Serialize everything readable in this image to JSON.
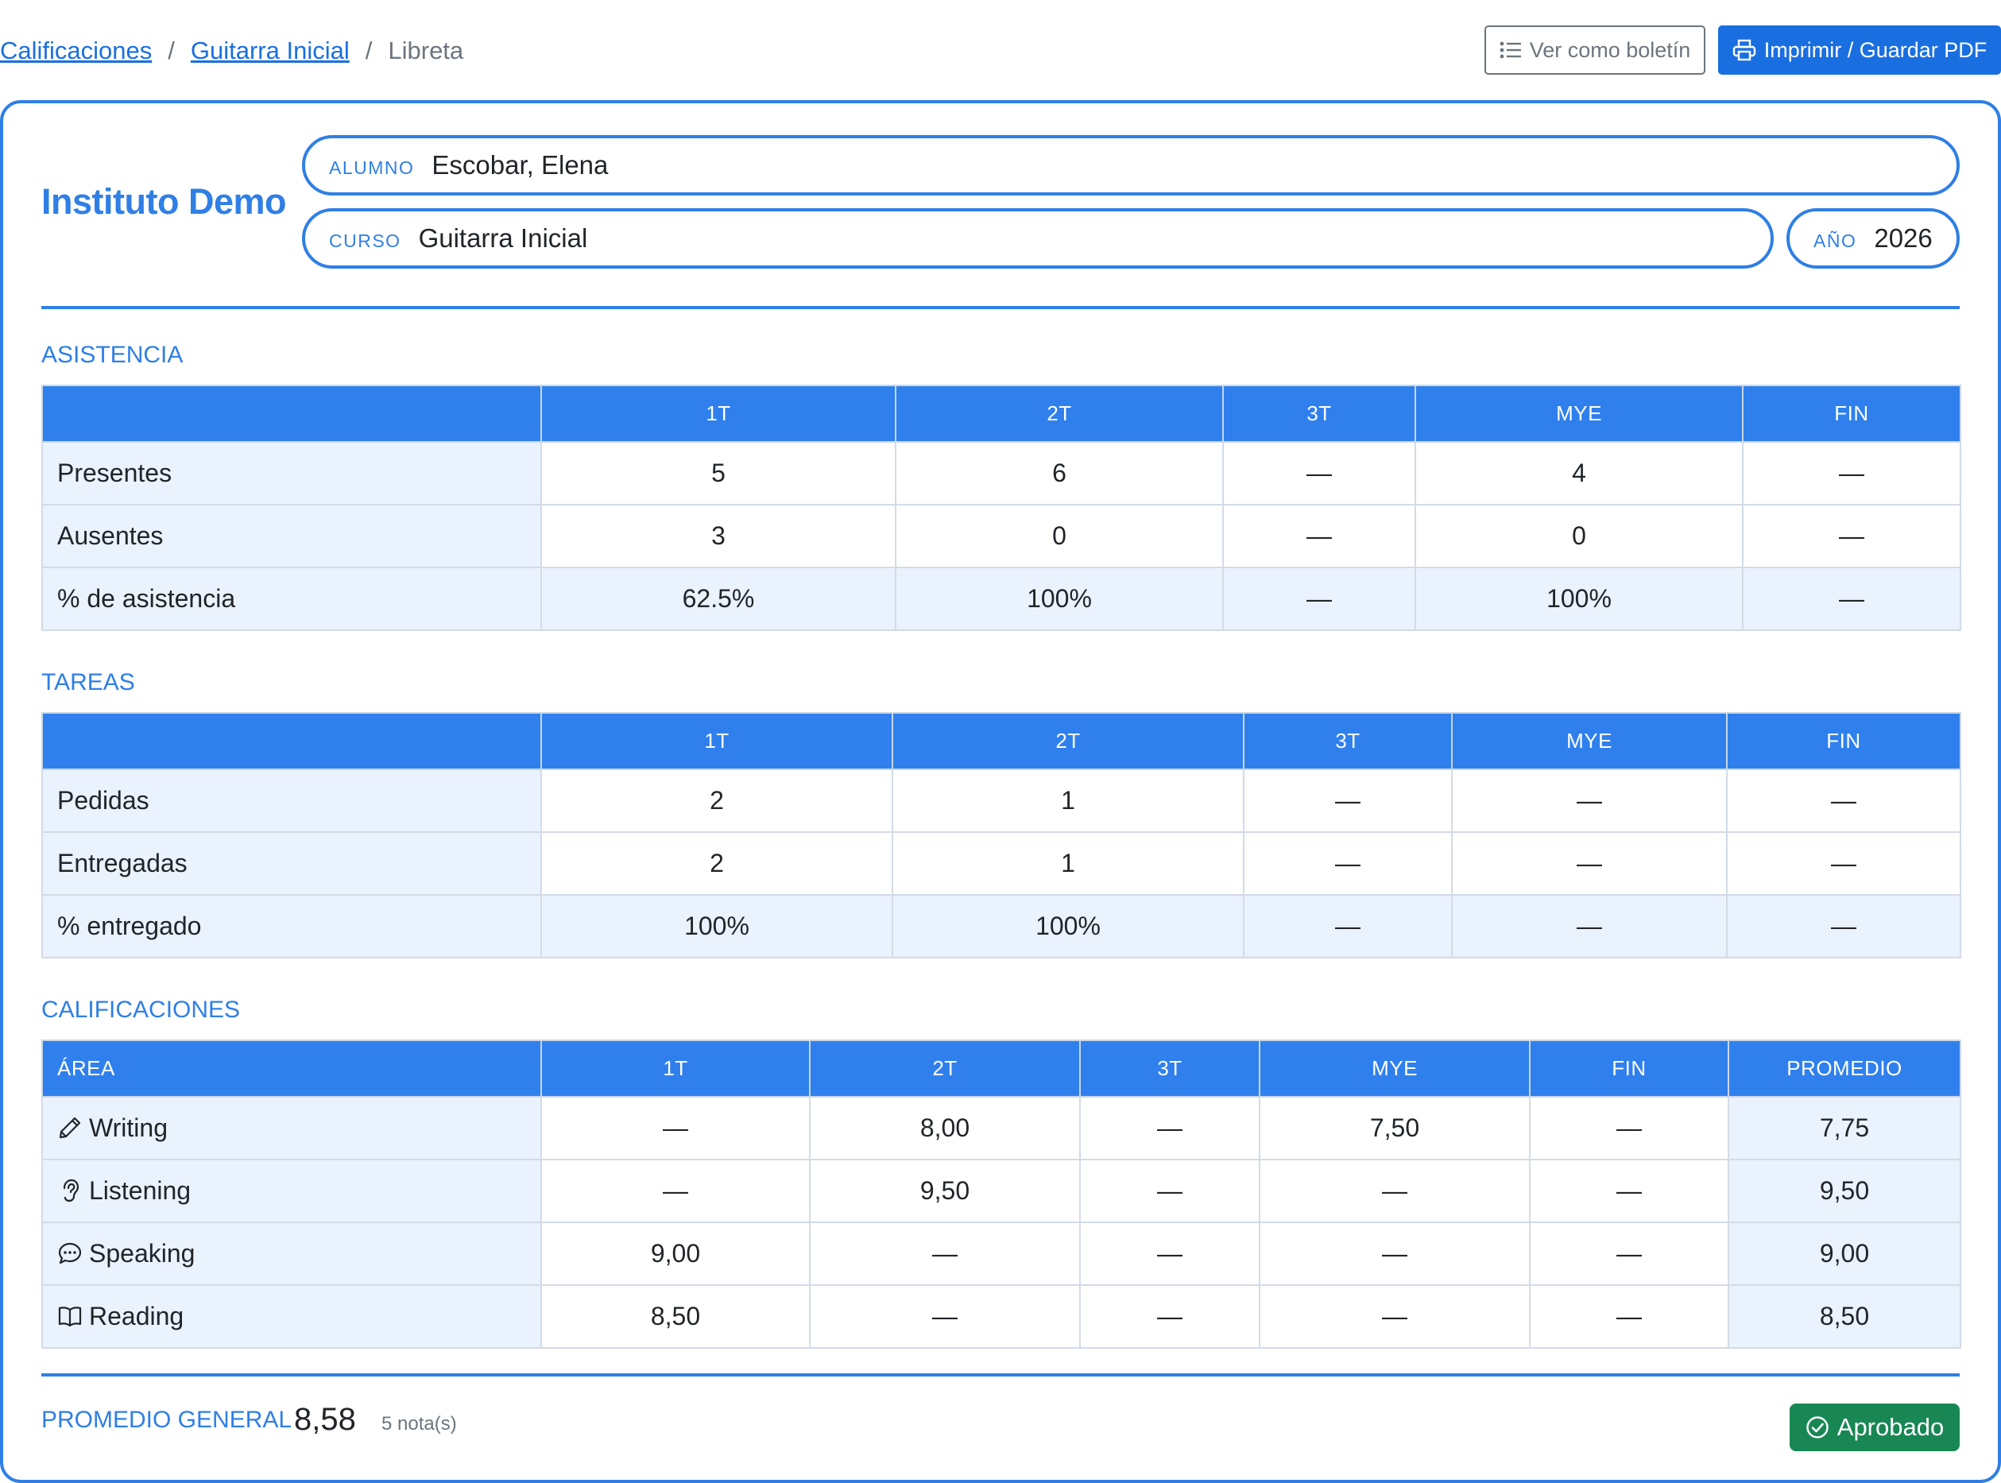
{
  "breadcrumb": {
    "item1": "Calificaciones",
    "item2": "Guitarra Inicial",
    "current": "Libreta",
    "separator": "/"
  },
  "toolbar": {
    "report_label": "Ver como boletín",
    "print_label": "Imprimir / Guardar PDF"
  },
  "header": {
    "school": "Instituto Demo",
    "student_label": "ALUMNO",
    "student": "Escobar, Elena",
    "course_label": "CURSO",
    "course": "Guitarra Inicial",
    "year_label": "AÑO",
    "year": "2026"
  },
  "attendance": {
    "title": "ASISTENCIA",
    "columns": [
      "",
      "1T",
      "2T",
      "3T",
      "MYE",
      "FIN"
    ],
    "rows": [
      {
        "label": "Presentes",
        "values": [
          "5",
          "6",
          "—",
          "4",
          "—"
        ]
      },
      {
        "label": "Ausentes",
        "values": [
          "3",
          "0",
          "—",
          "0",
          "—"
        ]
      },
      {
        "label": "% de asistencia",
        "values": [
          "62.5%",
          "100%",
          "—",
          "100%",
          "—"
        ]
      }
    ]
  },
  "tasks": {
    "title": "TAREAS",
    "columns": [
      "",
      "1T",
      "2T",
      "3T",
      "MYE",
      "FIN"
    ],
    "rows": [
      {
        "label": "Pedidas",
        "values": [
          "2",
          "1",
          "—",
          "—",
          "—"
        ]
      },
      {
        "label": "Entregadas",
        "values": [
          "2",
          "1",
          "—",
          "—",
          "—"
        ]
      },
      {
        "label": "% entregado",
        "values": [
          "100%",
          "100%",
          "—",
          "—",
          "—"
        ]
      }
    ]
  },
  "grades": {
    "title": "CALIFICACIONES",
    "columns": [
      "ÁREA",
      "1T",
      "2T",
      "3T",
      "MYE",
      "FIN",
      "PROMEDIO"
    ],
    "rows": [
      {
        "label": "Writing",
        "icon": "pencil-icon",
        "values": [
          "—",
          "8,00",
          "—",
          "7,50",
          "—"
        ],
        "avg": "7,75"
      },
      {
        "label": "Listening",
        "icon": "ear-icon",
        "values": [
          "—",
          "9,50",
          "—",
          "—",
          "—"
        ],
        "avg": "9,50"
      },
      {
        "label": "Speaking",
        "icon": "chat-dots-icon",
        "values": [
          "9,00",
          "—",
          "—",
          "—",
          "—"
        ],
        "avg": "9,00"
      },
      {
        "label": "Reading",
        "icon": "book-icon",
        "values": [
          "8,50",
          "—",
          "—",
          "—",
          "—"
        ],
        "avg": "8,50"
      }
    ]
  },
  "summary": {
    "label": "PROMEDIO GENERAL",
    "value": "8,58",
    "count": "5 nota(s)",
    "status": "Aprobado"
  },
  "colors": {
    "accent": "#2f7fe5",
    "button_primary": "#1a6fe0",
    "status_ok": "#198754"
  }
}
